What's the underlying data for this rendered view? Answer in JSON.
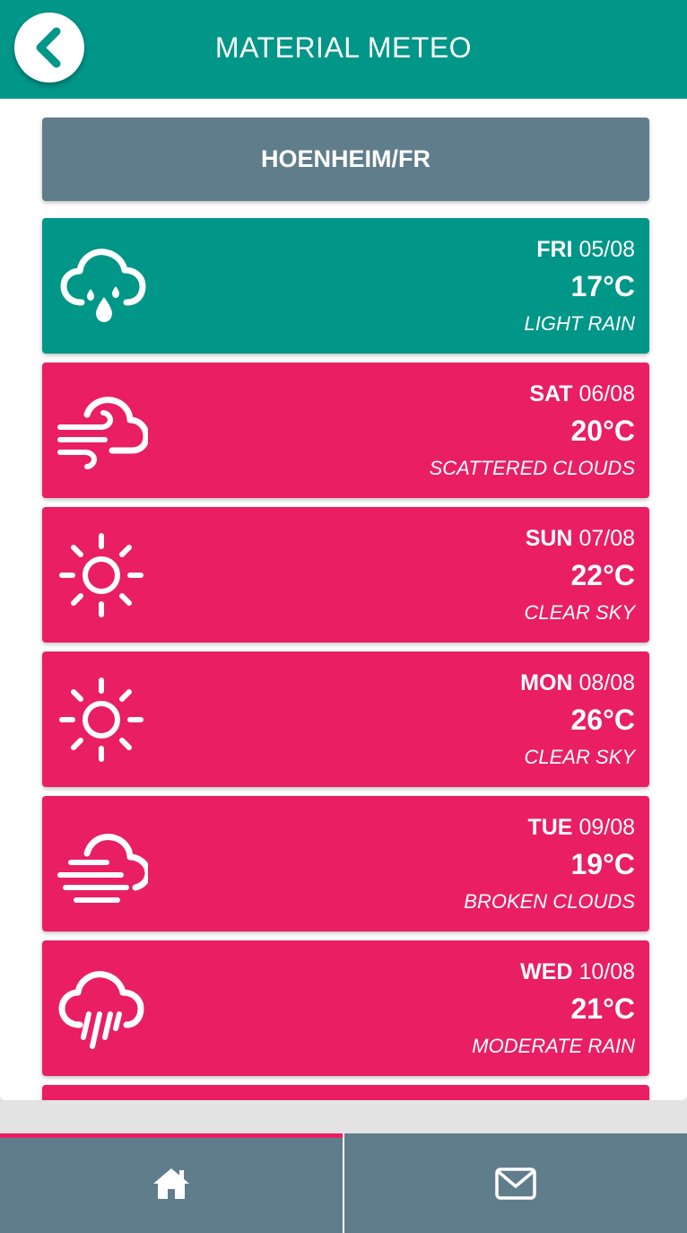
{
  "header": {
    "title": "MATERIAL METEO",
    "back_icon": "chevron-left-icon"
  },
  "city": {
    "label": "HOENHEIM/FR"
  },
  "colors": {
    "header": "#009688",
    "current_day": "#009688",
    "forecast_day": "#e91e63",
    "city_bar": "#607d8b",
    "tabbar": "#607d8b",
    "tab_indicator": "#e91e63"
  },
  "forecast": [
    {
      "day": "FRI",
      "date": "05/08",
      "temp": "17°C",
      "desc": "LIGHT RAIN",
      "icon": "cloud-drizzle-icon",
      "current": true
    },
    {
      "day": "SAT",
      "date": "06/08",
      "temp": "20°C",
      "desc": "SCATTERED CLOUDS",
      "icon": "cloud-wind-icon",
      "current": false
    },
    {
      "day": "SUN",
      "date": "07/08",
      "temp": "22°C",
      "desc": "CLEAR SKY",
      "icon": "sun-icon",
      "current": false
    },
    {
      "day": "MON",
      "date": "08/08",
      "temp": "26°C",
      "desc": "CLEAR SKY",
      "icon": "sun-icon",
      "current": false
    },
    {
      "day": "TUE",
      "date": "09/08",
      "temp": "19°C",
      "desc": "BROKEN CLOUDS",
      "icon": "cloud-fog-icon",
      "current": false
    },
    {
      "day": "WED",
      "date": "10/08",
      "temp": "21°C",
      "desc": "MODERATE RAIN",
      "icon": "cloud-rain-icon",
      "current": false
    }
  ],
  "tabs": {
    "home_icon": "home-icon",
    "mail_icon": "mail-icon",
    "active": "home"
  }
}
